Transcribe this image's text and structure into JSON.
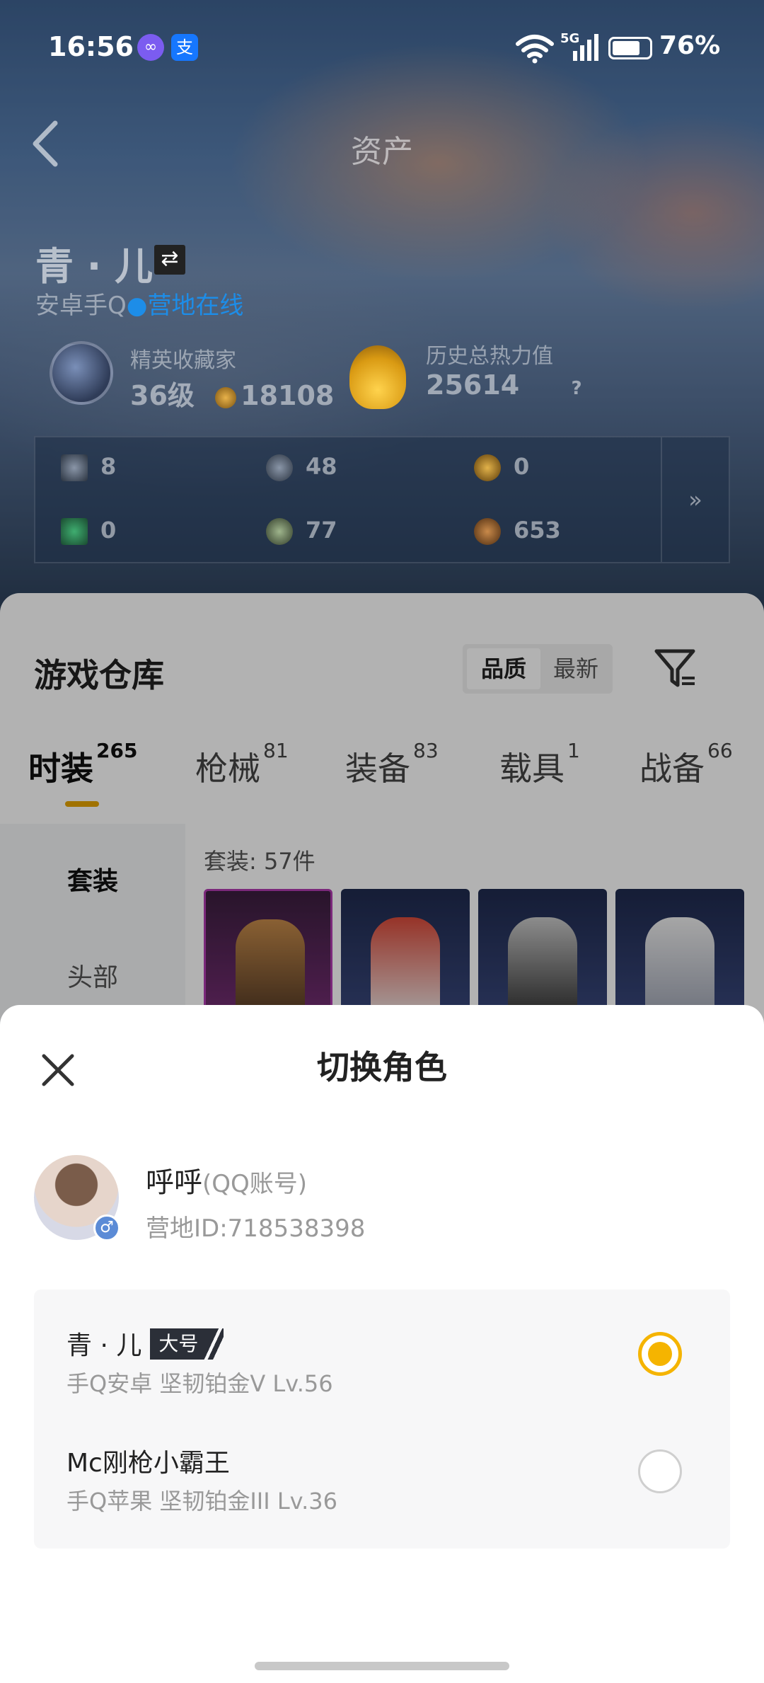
{
  "status_bar": {
    "time": "16:56",
    "app_icon_1": "∞",
    "app_icon_2": "支",
    "network": "5G",
    "battery": "76%",
    "battery_level": 0.76
  },
  "header": {
    "title": "资产"
  },
  "profile": {
    "name": "青 · 儿",
    "platform": "安卓手Q",
    "online_status": "营地在线",
    "collector": {
      "label": "精英收藏家",
      "level": "36级",
      "points": "18108"
    },
    "power": {
      "label": "历史总热力值",
      "value": "25614",
      "help": "?"
    }
  },
  "resources": [
    {
      "value": "8"
    },
    {
      "value": "48"
    },
    {
      "value": "0"
    },
    {
      "value": "0"
    },
    {
      "value": "77"
    },
    {
      "value": "653"
    }
  ],
  "resources_more": "»",
  "warehouse": {
    "title": "游戏仓库",
    "sort_options": [
      "品质",
      "最新"
    ],
    "tabs": [
      {
        "label": "时装",
        "count": "265"
      },
      {
        "label": "枪械",
        "count": "81"
      },
      {
        "label": "装备",
        "count": "83"
      },
      {
        "label": "载具",
        "count": "1"
      },
      {
        "label": "战备",
        "count": "66"
      }
    ],
    "categories": [
      "套装",
      "头部"
    ],
    "count_label": "套装: 57件"
  },
  "sheet": {
    "title": "切换角色",
    "account": {
      "name": "呼呼",
      "type": "(QQ账号)",
      "id": "营地ID:718538398",
      "gender": "♂"
    },
    "roles": [
      {
        "name": "青 · 儿",
        "badge": "大号",
        "sub": "手Q安卓  坚韧铂金V  Lv.56",
        "selected": true
      },
      {
        "name": "Mc刚枪小霸王",
        "badge": "",
        "sub": "手Q苹果  坚韧铂金III  Lv.36",
        "selected": false
      }
    ]
  },
  "colors": {
    "accent": "#f5b400",
    "online": "#1d8de8",
    "tab_underline": "#e5a400"
  }
}
